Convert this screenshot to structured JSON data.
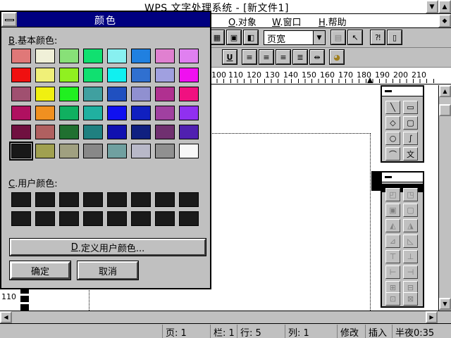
{
  "app": {
    "title": "WPS 文字处理系统 - [新文件1]"
  },
  "menu": [
    {
      "key": "O",
      "label": ".对象"
    },
    {
      "key": "W",
      "label": ".窗口"
    },
    {
      "key": "H",
      "label": ".帮助"
    }
  ],
  "toolbar": {
    "zoom_value": "页宽"
  },
  "ruler": {
    "labels": [
      "100",
      "110",
      "120",
      "130",
      "140",
      "150",
      "160",
      "170",
      "180",
      "190",
      "200",
      "210"
    ]
  },
  "left_ruler": {
    "label": "110"
  },
  "dialog": {
    "title": "颜色",
    "basic_label_key": "B",
    "basic_label": ".基本颜色:",
    "custom_label_key": "C",
    "custom_label": ".用户颜色:",
    "define_key": "D",
    "define_label": ".定义用户颜色...",
    "ok": "确定",
    "cancel": "取消",
    "basic_colors": [
      [
        "#e07878",
        "#f0f0d8",
        "#88e078",
        "#10e070",
        "#88f0f0",
        "#2080e0",
        "#e080d0",
        "#e080f0"
      ],
      [
        "#f01010",
        "#f0f078",
        "#90f020",
        "#10e070",
        "#10f0f0",
        "#3070d0",
        "#a0a0e0",
        "#f010f0"
      ],
      [
        "#a05070",
        "#f0f010",
        "#20f020",
        "#40a0a0",
        "#2050c0",
        "#9090d0",
        "#b03090",
        "#f01080"
      ],
      [
        "#b01060",
        "#f09020",
        "#10b060",
        "#20b0a0",
        "#1010f0",
        "#1020c0",
        "#a040a0",
        "#9030f0"
      ],
      [
        "#701040",
        "#b06060",
        "#207030",
        "#208080",
        "#1010b0",
        "#102080",
        "#703070",
        "#5020b0"
      ],
      [
        "#181818",
        "#a0a050",
        "#a0a080",
        "#888888",
        "#70a0a0",
        "#b8b8c8",
        "#909090",
        "#f8f8f8"
      ]
    ]
  },
  "statusbar": {
    "page": "页: 1",
    "column": "栏: 1",
    "row": "行: 5",
    "col": "列: 1",
    "mode": "修改",
    "insert": "插入",
    "time": "半夜0:35"
  }
}
